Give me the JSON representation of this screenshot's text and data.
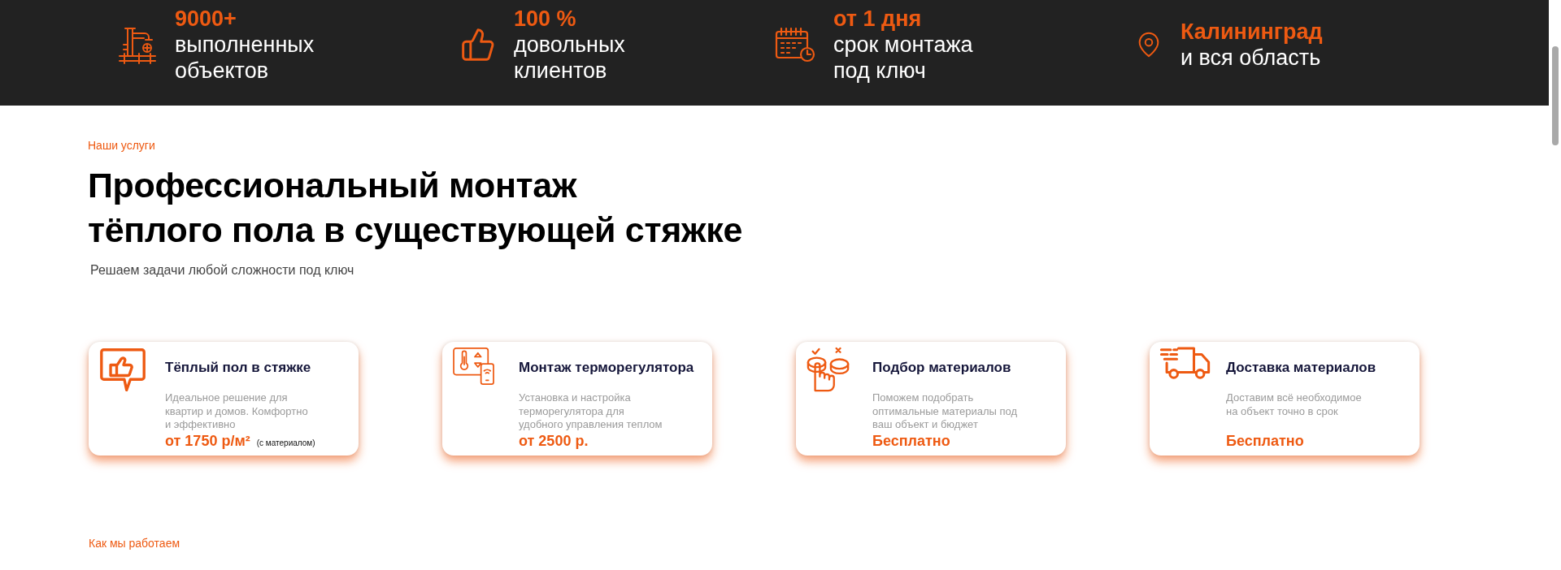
{
  "stats_bar": {
    "items": [
      {
        "value": "9000+",
        "label": "выполненных\nобъектов"
      },
      {
        "value": "100 %",
        "label": "довольных\nклиентов"
      },
      {
        "value": "от 1 дня",
        "label": "срок монтажа\nпод ключ"
      },
      {
        "value": "Калининград",
        "label": "и вся область"
      }
    ]
  },
  "services": {
    "eyebrow": "Наши услуги",
    "title": "Профессиональный монтаж\nтёплого пола в существующей стяжке",
    "subtitle": "Решаем задачи любой сложности под ключ",
    "cards": [
      {
        "title": "Тёплый пол в стяжке",
        "description": "Идеальное решение для\nквартир и домов. Комфортно\nи эффективно",
        "price": "от 1750 р/м²",
        "price_note": "(с материалом)"
      },
      {
        "title": "Монтаж терморегулятора",
        "description": "Установка и настройка\nтерморегулятора для\nудобного управления теплом",
        "price": "от 2500 р."
      },
      {
        "title": "Подбор материалов",
        "description": "Поможем подобрать\nоптимальные материалы под\nваш объект и бюджет",
        "price": "Бесплатно"
      },
      {
        "title": "Доставка материалов",
        "description": "Доставим всё необходимое\nна объект точно в срок",
        "price": "Бесплатно"
      }
    ]
  },
  "next_section": {
    "eyebrow": "Как мы работаем"
  }
}
